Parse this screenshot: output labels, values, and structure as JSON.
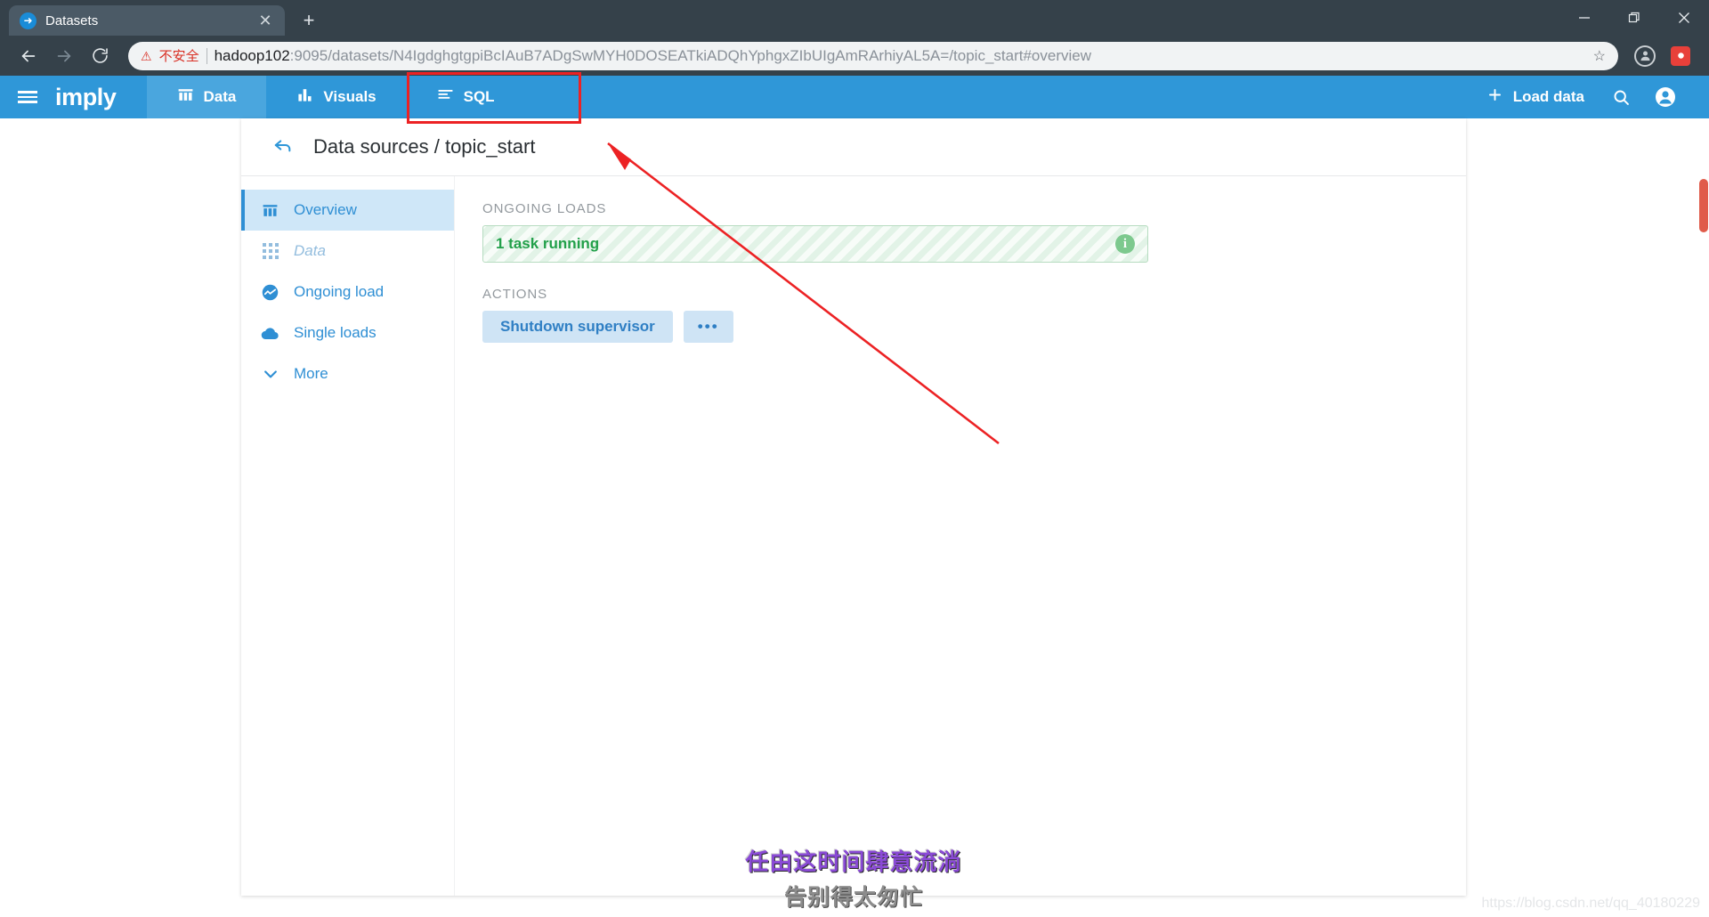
{
  "browser": {
    "tab": {
      "title": "Datasets",
      "favicon": "arrow-right-circle-icon",
      "close": "✕"
    },
    "new_tab_label": "+",
    "window_controls": {
      "minimize": "minimize-icon",
      "maximize": "restore-icon",
      "close": "close-icon"
    },
    "nav": {
      "back": "back-icon",
      "forward": "forward-icon",
      "reload": "reload-icon"
    },
    "omnibox": {
      "security_warning": "不安全",
      "url_host": "hadoop102",
      "url_rest": ":9095/datasets/N4IgdghgtgpiBcIAuB7ADgSwMYH0DOSEATkiADQhYphgxZIbUIgAmRArhiyAL5A=/topic_start#overview",
      "full_url": "hadoop102:9095/datasets/N4IgdghgtgpiBcIAuB7ADgSwMYH0DOSEATkiADQhYphgxZIbUIgAmRArhiyAL5A=/topic_start#overview",
      "bookmark_icon": "star-icon"
    },
    "toolbar_icons": {
      "profile": "profile-avatar-icon",
      "extension": "extension-icon"
    }
  },
  "app": {
    "brand": "imply",
    "menu_icon": "hamburger-menu-icon",
    "tabs": [
      {
        "label": "Data",
        "icon": "table-icon",
        "active": true
      },
      {
        "label": "Visuals",
        "icon": "bar-chart-icon",
        "active": false
      },
      {
        "label": "SQL",
        "icon": "sql-lines-icon",
        "active": false,
        "highlighted": true
      }
    ],
    "right": {
      "load_data_label": "Load data",
      "load_data_icon": "plus-icon",
      "search_icon": "search-icon",
      "account_icon": "account-circle-icon"
    }
  },
  "page": {
    "back_icon": "back-arrow-icon",
    "breadcrumb": "Data sources / topic_start",
    "sidebar": [
      {
        "label": "Overview",
        "icon": "overview-columns-icon",
        "state": "active"
      },
      {
        "label": "Data",
        "icon": "grid-dots-icon",
        "state": "muted"
      },
      {
        "label": "Ongoing load",
        "icon": "ongoing-load-icon",
        "state": "normal"
      },
      {
        "label": "Single loads",
        "icon": "cloud-upload-icon",
        "state": "normal"
      },
      {
        "label": "More",
        "icon": "chevron-down-icon",
        "state": "normal"
      }
    ],
    "ongoing_loads": {
      "section_label": "ONGOING LOADS",
      "status_text": "1 task running",
      "info_icon": "info-icon",
      "accent_color": "#22a04a"
    },
    "actions": {
      "section_label": "ACTIONS",
      "primary_button": "Shutdown supervisor",
      "more_button": "•••"
    }
  },
  "annotations": {
    "highlight_color": "#ec2224",
    "arrow": "red-arrow-pointing-to-sql-tab"
  },
  "watermarks": {
    "center_line1": "任由这时间肆意流淌",
    "center_line2": "告别得太匆忙",
    "corner": "https://blog.csdn.net/qq_40180229"
  }
}
